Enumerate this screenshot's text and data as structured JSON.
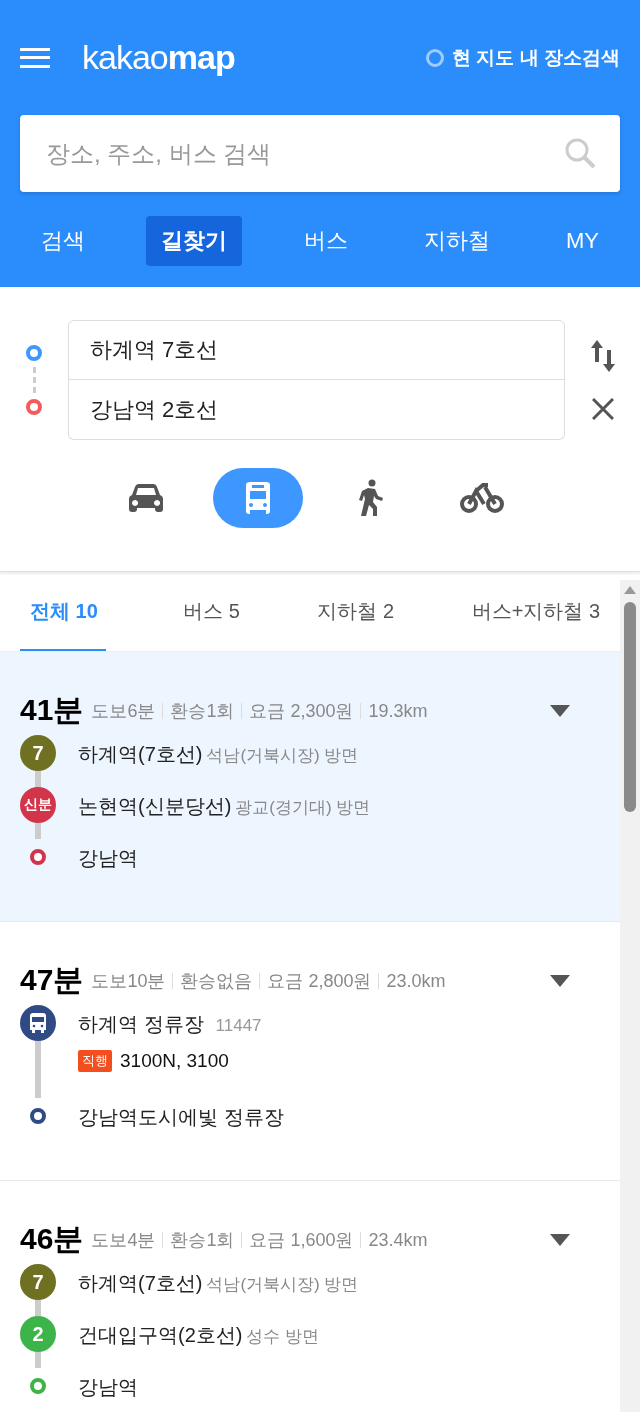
{
  "header": {
    "logo": "kakao**map**",
    "map_search": {
      "label": "현 지도 내 장소검색",
      "checked": false
    },
    "search": {
      "placeholder": "장소, 주소, 버스 검색"
    },
    "tabs": [
      {
        "label": "검색",
        "selected": false
      },
      {
        "label": "길찾기",
        "selected": true
      },
      {
        "label": "버스",
        "selected": false
      },
      {
        "label": "지하철",
        "selected": false
      },
      {
        "label": "MY",
        "selected": false
      }
    ]
  },
  "directions": {
    "origin": "하계역 7호선",
    "destination": "강남역 2호선",
    "modes": [
      {
        "kind": "car",
        "selected": false
      },
      {
        "kind": "bus",
        "selected": true
      },
      {
        "kind": "walk",
        "selected": false
      },
      {
        "kind": "bike",
        "selected": false
      }
    ]
  },
  "result_tabs": [
    {
      "label": "전체 10",
      "selected": true
    },
    {
      "label": "버스 5",
      "selected": false
    },
    {
      "label": "지하철 2",
      "selected": false
    },
    {
      "label": "버스+지하철 3",
      "selected": false
    }
  ],
  "routes": [
    {
      "time": "41분",
      "details": [
        "도보6분",
        "환승1회",
        "요금 2,300원",
        "19.3km"
      ],
      "selected": true,
      "steps": [
        {
          "kind": "line",
          "badge": "7",
          "color": "#6f7021",
          "name": "하계역(7호선)",
          "direction": "석남(거북시장) 방면"
        },
        {
          "kind": "line",
          "badge": "신분",
          "color": "#d2344a",
          "name": "논현역(신분당선)",
          "direction": "광교(경기대) 방면"
        },
        {
          "kind": "end",
          "color": "#d2344a",
          "name": "강남역"
        }
      ]
    },
    {
      "time": "47분",
      "details": [
        "도보10분",
        "환승없음",
        "요금 2,800원",
        "23.0km"
      ],
      "selected": false,
      "steps": [
        {
          "kind": "bus",
          "color": "#2f4a84",
          "name": "하계역 정류장",
          "code": "11447",
          "tag": "직행",
          "buses": "3100N, 3100"
        },
        {
          "kind": "end",
          "color": "#2f4a84",
          "name": "강남역도시에빛 정류장"
        }
      ]
    },
    {
      "time": "46분",
      "details": [
        "도보4분",
        "환승1회",
        "요금 1,600원",
        "23.4km"
      ],
      "selected": false,
      "steps": [
        {
          "kind": "line",
          "badge": "7",
          "color": "#6f7021",
          "name": "하계역(7호선)",
          "direction": "석남(거북시장) 방면"
        },
        {
          "kind": "line",
          "badge": "2",
          "color": "#3cb44a",
          "name": "건대입구역(2호선)",
          "direction": "성수 방면"
        },
        {
          "kind": "end",
          "color": "#3cb44a",
          "name": "강남역"
        }
      ]
    }
  ]
}
